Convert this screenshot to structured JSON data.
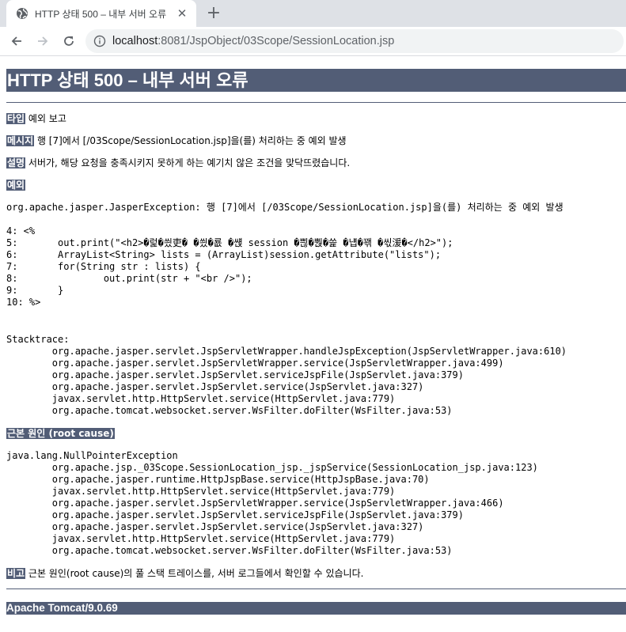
{
  "browser": {
    "tab_title": "HTTP 상태 500 – 내부 서버 오류",
    "url_host": "localhost",
    "url_rest": ":8081/JspObject/03Scope/SessionLocation.jsp"
  },
  "page": {
    "title": "HTTP 상태 500 – 내부 서버 오류",
    "type": {
      "label": "타입",
      "text": " 예외 보고"
    },
    "message": {
      "label": "메시지",
      "text": " 행 [7]에서 [/03Scope/SessionLocation.jsp]을(를) 처리하는 중 예외 발생"
    },
    "description": {
      "label": "설명",
      "text": " 서버가, 해당 요청을 충족시키지 못하게 하는 예기치 않은 조건을 맞닥뜨렸습니다."
    },
    "exception": {
      "label": "예외",
      "line": "org.apache.jasper.JasperException: 행 [7]에서 [/03Scope/SessionLocation.jsp]을(를) 처리하는 중 예외 발생",
      "code": [
        "4: <%",
        "5: \tout.print(\"<h2>�럹�씠吏� �씠�룞 �썑 session �쁺�뿭�쓽 �냽�꽦 �씫湲�</h2>\");",
        "6: \tArrayList<String> lists = (ArrayList)session.getAttribute(\"lists\");",
        "7: \tfor(String str : lists) {",
        "8: \t\tout.print(str + \"<br />\");",
        "9: \t}",
        "10: %>"
      ],
      "stacktrace_label": "Stacktrace:",
      "stacktrace": [
        "org.apache.jasper.servlet.JspServletWrapper.handleJspException(JspServletWrapper.java:610)",
        "org.apache.jasper.servlet.JspServletWrapper.service(JspServletWrapper.java:499)",
        "org.apache.jasper.servlet.JspServlet.serviceJspFile(JspServlet.java:379)",
        "org.apache.jasper.servlet.JspServlet.service(JspServlet.java:327)",
        "javax.servlet.http.HttpServlet.service(HttpServlet.java:779)",
        "org.apache.tomcat.websocket.server.WsFilter.doFilter(WsFilter.java:53)"
      ]
    },
    "root_cause": {
      "label": "근본 원인 (root cause)",
      "exception": "java.lang.NullPointerException",
      "stacktrace": [
        "org.apache.jsp._03Scope.SessionLocation_jsp._jspService(SessionLocation_jsp.java:123)",
        "org.apache.jasper.runtime.HttpJspBase.service(HttpJspBase.java:70)",
        "javax.servlet.http.HttpServlet.service(HttpServlet.java:779)",
        "org.apache.jasper.servlet.JspServletWrapper.service(JspServletWrapper.java:466)",
        "org.apache.jasper.servlet.JspServlet.serviceJspFile(JspServlet.java:379)",
        "org.apache.jasper.servlet.JspServlet.service(JspServlet.java:327)",
        "javax.servlet.http.HttpServlet.service(HttpServlet.java:779)",
        "org.apache.tomcat.websocket.server.WsFilter.doFilter(WsFilter.java:53)"
      ]
    },
    "note": {
      "label": "비고",
      "text": " 근본 원인(root cause)의 풀 스택 트레이스를, 서버 로그들에서 확인할 수 있습니다."
    },
    "footer": "Apache Tomcat/9.0.69"
  },
  "colors": {
    "header_bg": "#525d76",
    "tabstrip_bg": "#dee1e6",
    "omnibox_bg": "#f1f3f4"
  }
}
